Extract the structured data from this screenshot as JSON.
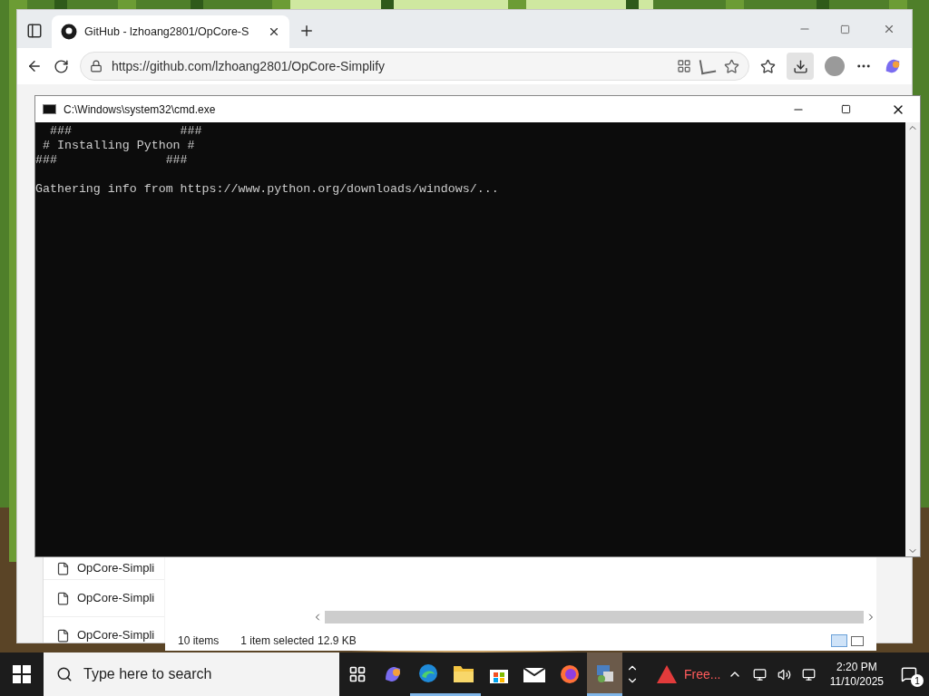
{
  "browser": {
    "tab_title": "GitHub - lzhoang2801/OpCore-S",
    "url": "https://github.com/lzhoang2801/OpCore-Simplify"
  },
  "files": [
    {
      "name": "OpCore-Simpli"
    },
    {
      "name": "OpCore-Simpli"
    },
    {
      "name": "OpCore-Simpli"
    }
  ],
  "explorer_status": [
    "10 items",
    "1 item selected",
    "12.9 KB"
  ],
  "console": {
    "title": "C:\\Windows\\system32\\cmd.exe",
    "banner": [
      "  ###               ###",
      " # Installing Python #",
      "###               ###"
    ],
    "message": "Gathering info from https://www.python.org/downloads/windows/..."
  },
  "taskbar": {
    "search_placeholder": "Type here to search",
    "apps": [
      {
        "kind": "taskview",
        "running": false,
        "selected": false
      },
      {
        "kind": "copilot",
        "running": false,
        "selected": false
      },
      {
        "kind": "edge",
        "running": true,
        "selected": false
      },
      {
        "kind": "explorer",
        "running": true,
        "selected": false
      },
      {
        "kind": "store",
        "running": false,
        "selected": false
      },
      {
        "kind": "mail",
        "running": false,
        "selected": false
      },
      {
        "kind": "firefox",
        "running": false,
        "selected": false
      },
      {
        "kind": "tool",
        "running": true,
        "selected": true
      }
    ],
    "alert": "Free...",
    "time": "2:20 PM",
    "date": "11/10/2025",
    "notifications": "1"
  }
}
